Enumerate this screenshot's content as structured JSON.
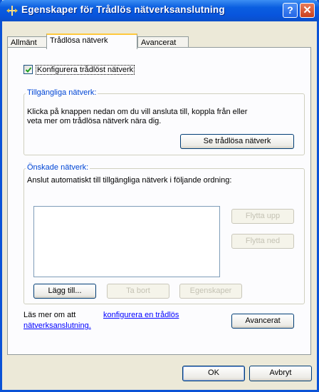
{
  "window": {
    "title": "Egenskaper för Trådlös nätverksanslutning",
    "help_button": "?",
    "close_button": "✕"
  },
  "tabs": [
    {
      "label": "Allmänt",
      "active": false
    },
    {
      "label": "Trådlösa nätverk",
      "active": true
    },
    {
      "label": "Avancerat",
      "active": false
    }
  ],
  "configure_checkbox": {
    "label": "Konfigurera trådlöst nätverk",
    "checked": true
  },
  "available_networks": {
    "legend": "Tillgängliga nätverk:",
    "description_line1": "Klicka på knappen nedan om du vill ansluta till, koppla från eller",
    "description_line2": "veta mer om trådlösa nätverk nära dig.",
    "view_button": "Se trådlösa nätverk"
  },
  "preferred_networks": {
    "legend": "Önskade nätverk:",
    "description": "Anslut automatiskt till tillgängliga nätverk i följande ordning:",
    "move_up_button": "Flytta upp",
    "move_down_button": "Flytta ned",
    "add_button": "Lägg till...",
    "remove_button": "Ta bort",
    "properties_button": "Egenskaper"
  },
  "learn_more": {
    "prefix": "Läs mer om att ",
    "link_line1": "konfigurera en trådlös",
    "link_line2": "nätverksanslutning."
  },
  "advanced_button": "Avancerat",
  "ok_button": "OK",
  "cancel_button": "Avbryt"
}
